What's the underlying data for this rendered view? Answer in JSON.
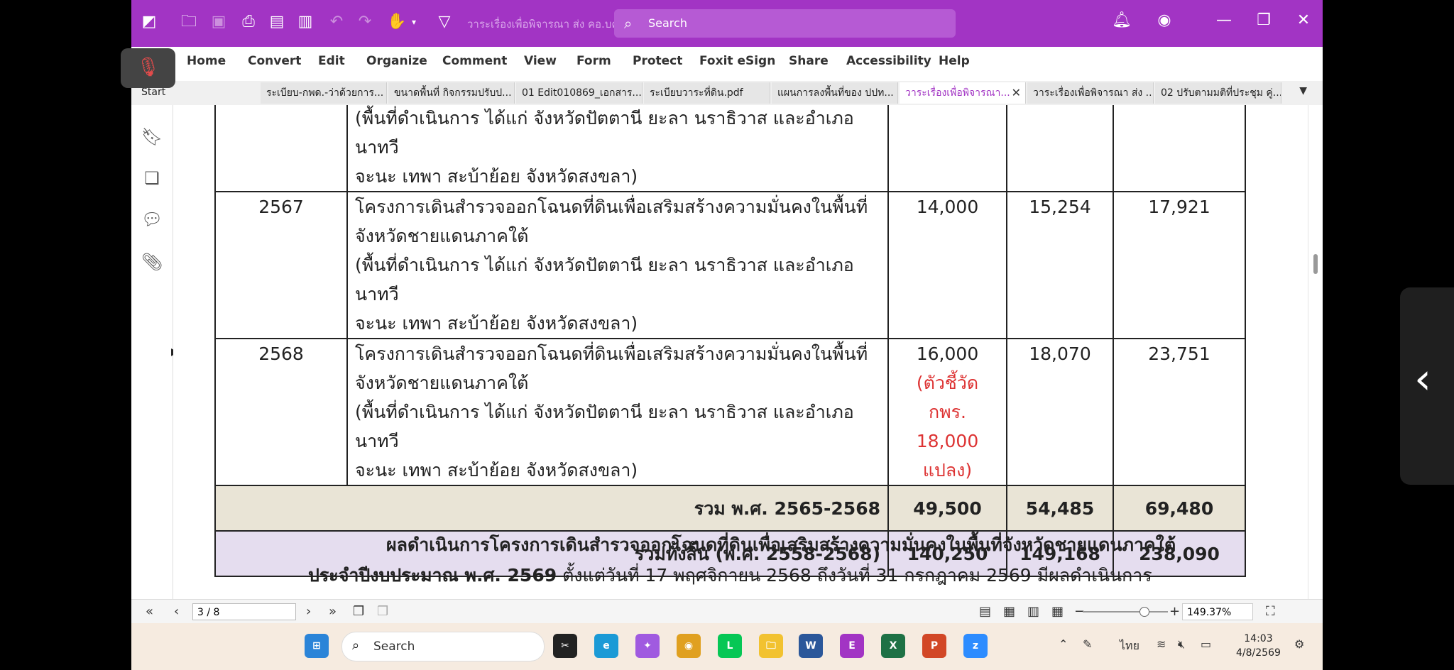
{
  "titlebar": {
    "doc_title": "วาระเรื่องเพื่อพิจารณา ส่ง คอ.บค...",
    "search_placeholder": "Search"
  },
  "menu": [
    "Home",
    "Convert",
    "Edit",
    "Organize",
    "Comment",
    "View",
    "Form",
    "Protect",
    "Foxit eSign",
    "Share",
    "Accessibility",
    "Help"
  ],
  "tabs": {
    "start": "Start",
    "items": [
      "ระเบียบ-กพด.-ว่าด้วยการ...",
      "ขนาดพื้นที่ กิจกรรมปรับป...",
      "01 Edit010869_เอกสาร...",
      "ระเบียบวาระที่ดิน.pdf",
      "แผนการลงพื้นที่ของ ปปท...",
      "วาระเรื่องเพื่อพิจารณา...",
      "วาระเรื่องเพื่อพิจารณา ส่ง ...",
      "02 ปรับตามมติที่ประชุม คู่..."
    ],
    "active_index": 5
  },
  "table": {
    "top_partial": {
      "lines": [
        "(พื้นที่ดำเนินการ ได้แก่ จังหวัดปัตตานี ยะลา นราธิวาส และอำเภอนาทวี",
        "จะนะ เทพา สะบ้าย้อย จังหวัดสงขลา)"
      ]
    },
    "rows": [
      {
        "year": "2567",
        "desc_lines": [
          "โครงการเดินสำรวจออกโฉนดที่ดินเพื่อเสริมสร้างความมั่นคงในพื้นที่",
          "จังหวัดชายแดนภาคใต้",
          "(พื้นที่ดำเนินการ ได้แก่ จังหวัดปัตตานี ยะลา นราธิวาส และอำเภอนาทวี",
          "จะนะ เทพา สะบ้าย้อย จังหวัดสงขลา)"
        ],
        "target": "14,000",
        "col4": "15,254",
        "col5": "17,921"
      },
      {
        "year": "2568",
        "desc_lines": [
          "โครงการเดินสำรวจออกโฉนดที่ดินเพื่อเสริมสร้างความมั่นคงในพื้นที่",
          "จังหวัดชายแดนภาคใต้",
          "(พื้นที่ดำเนินการ ได้แก่ จังหวัดปัตตานี ยะลา นราธิวาส และอำเภอนาทวี",
          "จะนะ เทพา สะบ้าย้อย จังหวัดสงขลา)"
        ],
        "target": "16,000",
        "note_1": "(ตัวชี้วัด กพร.",
        "note_2": "18,000 แปลง)",
        "col4": "18,070",
        "col5": "23,751"
      }
    ],
    "subtotal": {
      "label": "รวม พ.ศ. 2565-2568",
      "c3": "49,500",
      "c4": "54,485",
      "c5": "69,480"
    },
    "total": {
      "label": "รวมทั้งสิ้น (พ.ศ. 2558-2568)",
      "c3": "140,250",
      "c4": "149,168",
      "c5": "238,090"
    }
  },
  "paragraph": {
    "line1": "ผลดำเนินการโครงการเดินสำรวจออกโฉนดที่ดินเพื่อเสริมสร้างความมั่นคงในพื้นที่จังหวัดชายแดนภาคใต้",
    "line2_bold": "ประจำปีงบประมาณ พ.ศ. 2569",
    "line2_rest": " ตั้งแต่วันที่ 17 พฤศจิกายน 2568 ถึงวันที่ 31 กรกฎาคม 2569 มีผลดำเนินการ"
  },
  "statusbar": {
    "page": "3 / 8",
    "zoom": "149.37%"
  },
  "taskbar": {
    "search_placeholder": "Search",
    "lang": "ไทย",
    "time": "14:03",
    "date": "4/8/2569"
  },
  "colors": {
    "accent": "#a234c4",
    "subtotal_bg": "#e9e4d6",
    "total_bg": "#e5ddef",
    "note_red": "#d33333"
  }
}
